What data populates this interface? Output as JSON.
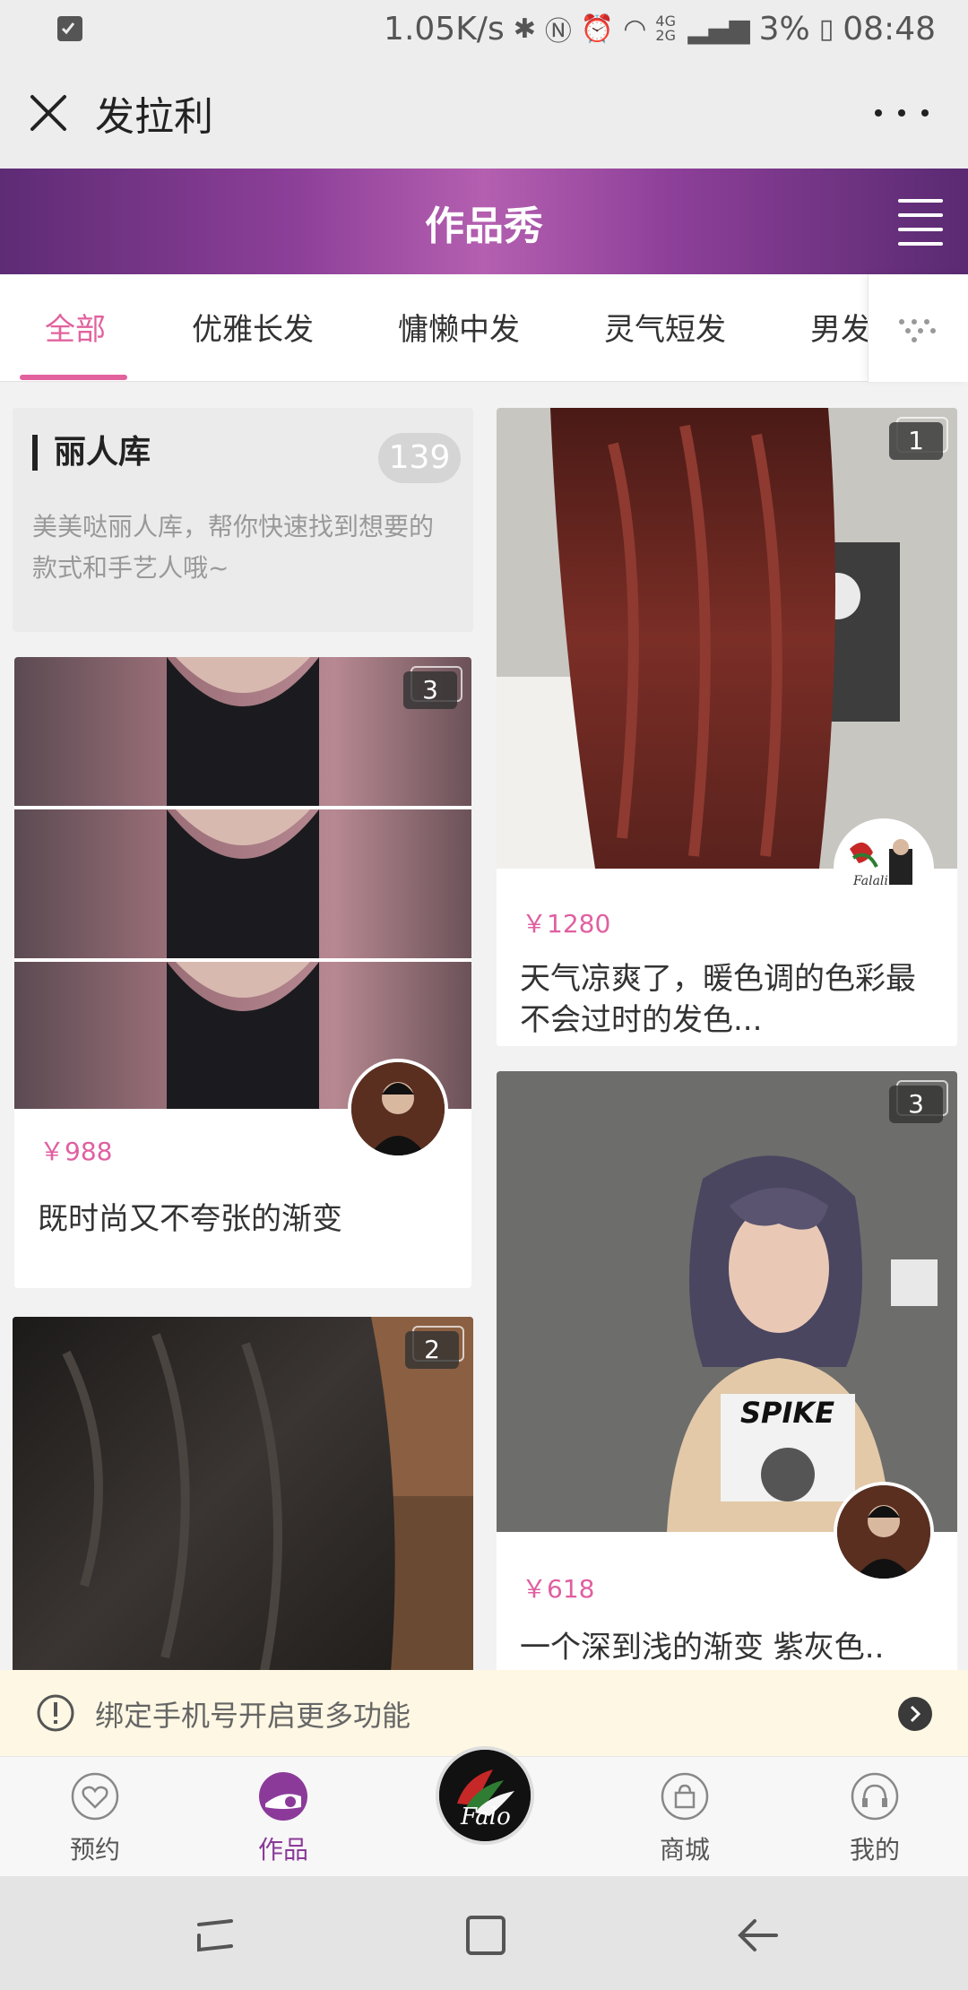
{
  "status_bar": {
    "net_speed": "1.05K/s",
    "signal_labels": "4G 2G",
    "battery": "3%",
    "time": "08:48"
  },
  "wx_header": {
    "title": "发拉利"
  },
  "banner": {
    "title": "作品秀"
  },
  "tabs": {
    "items": [
      {
        "label": "全部",
        "active": true
      },
      {
        "label": "优雅长发",
        "active": false
      },
      {
        "label": "慵懒中发",
        "active": false
      },
      {
        "label": "灵气短发",
        "active": false
      },
      {
        "label": "男发",
        "active": false
      }
    ]
  },
  "library": {
    "title": "丽人库",
    "count": "139",
    "description": "美美哒丽人库，帮你快速找到想要的款式和手艺人哦~"
  },
  "works": [
    {
      "badge": "3",
      "price": "￥988",
      "title": "既时尚又不夸张的渐变",
      "column": "left"
    },
    {
      "badge": "2",
      "price": "",
      "title": "",
      "column": "left"
    },
    {
      "badge": "1",
      "price": "￥1280",
      "title": "天气凉爽了，暖色调的色彩最不会过时的发色...",
      "column": "right",
      "avatar_caption": "Falali"
    },
    {
      "badge": "3",
      "price": "￥618",
      "title": "一个深到浅的渐变 紫灰色..",
      "column": "right",
      "shirt_text": "SPIKE"
    }
  ],
  "notice": {
    "text": "绑定手机号开启更多功能"
  },
  "bottom_nav": {
    "items": [
      {
        "label": "预约",
        "icon": "heart-icon",
        "active": false
      },
      {
        "label": "作品",
        "icon": "works-icon",
        "active": true
      },
      {
        "label": "",
        "icon": "brand-logo",
        "active": false
      },
      {
        "label": "商城",
        "icon": "bag-icon",
        "active": false
      },
      {
        "label": "我的",
        "icon": "headset-icon",
        "active": false
      }
    ],
    "logo_text": "Falo"
  },
  "colors": {
    "accent_pink": "#e2629e",
    "purple_brand": "#8b3a9a",
    "price_pink": "#e05fa0",
    "notice_bg": "#fdf7e3"
  }
}
